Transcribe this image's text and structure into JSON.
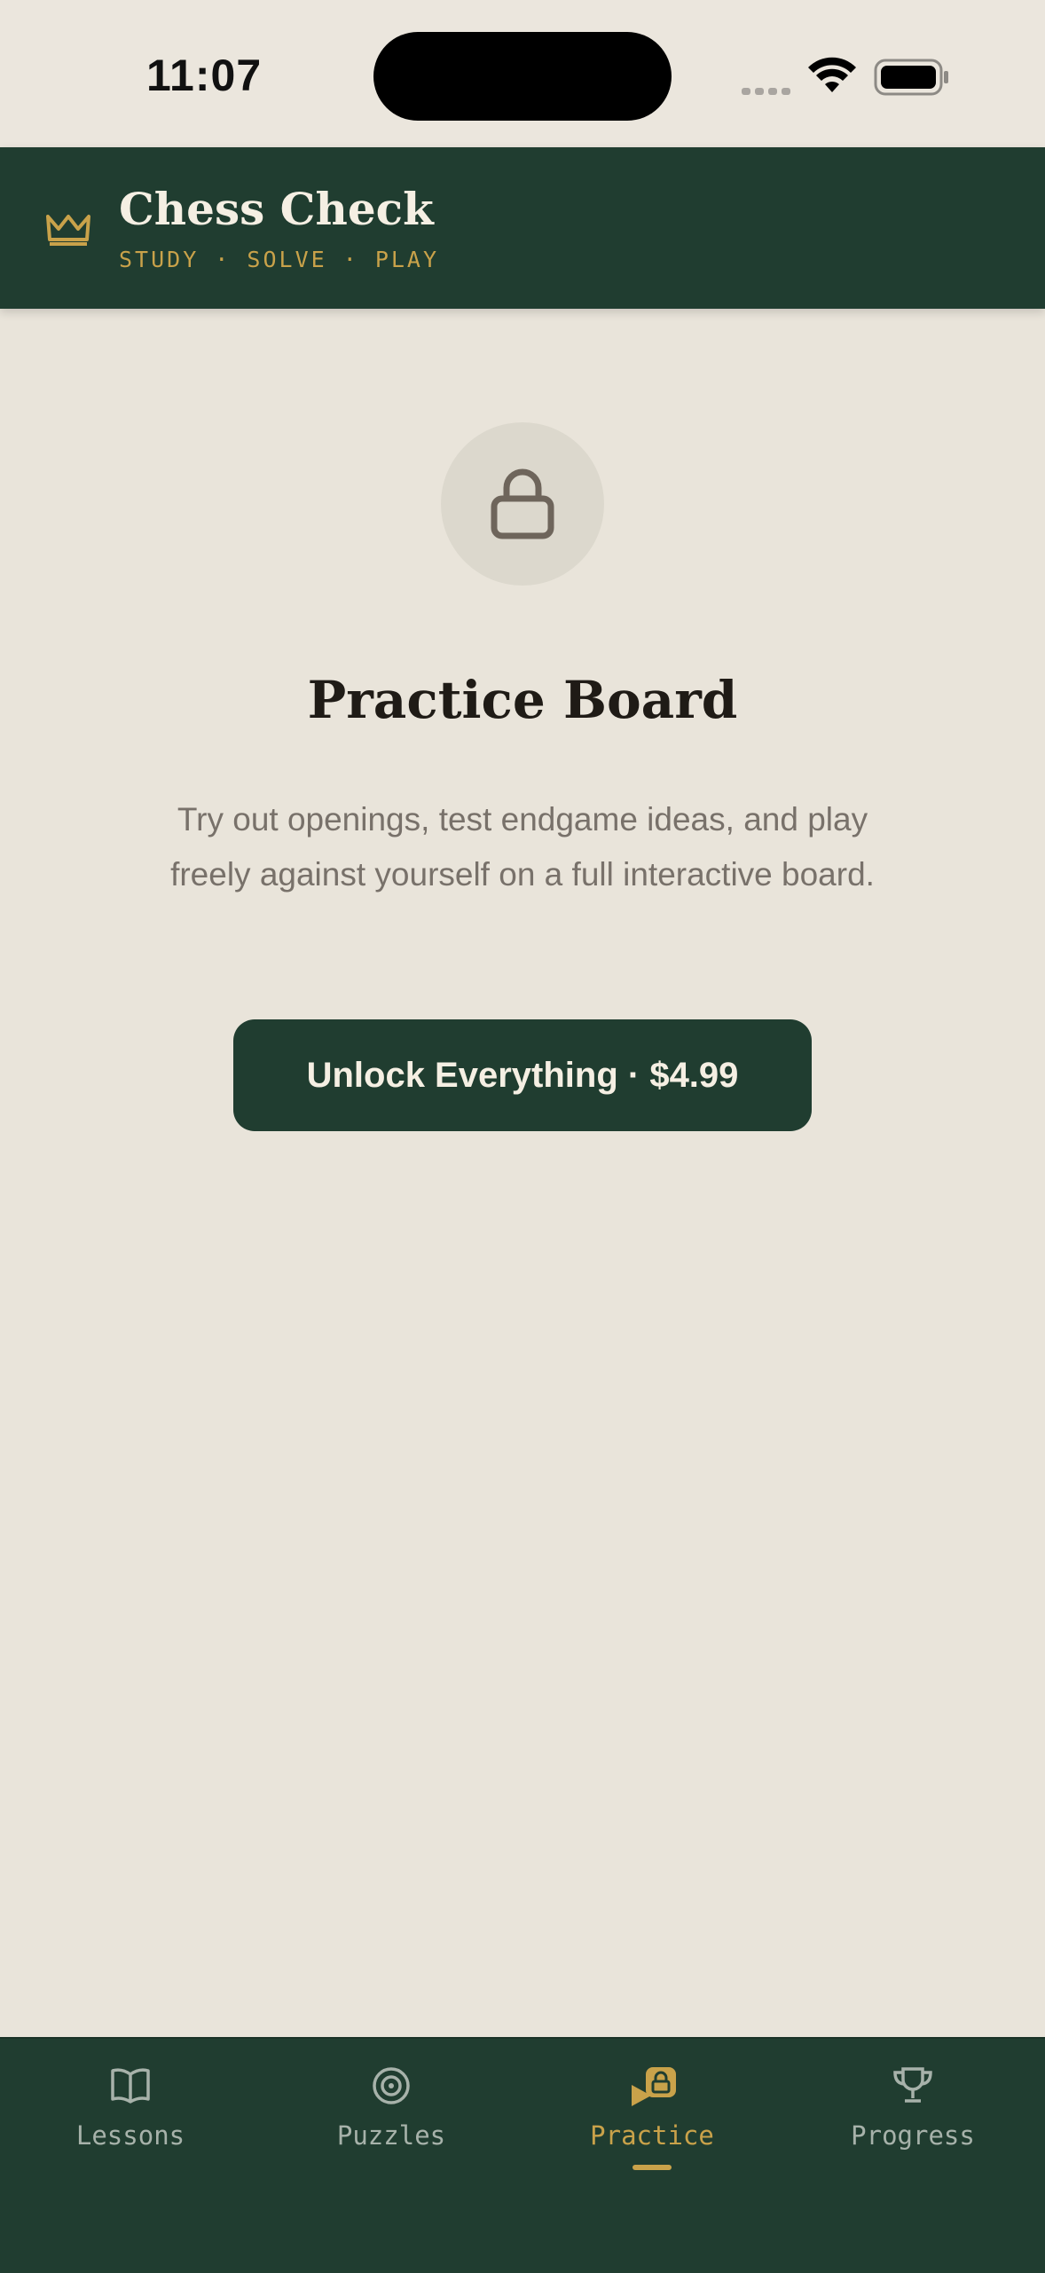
{
  "status_bar": {
    "time": "11:07"
  },
  "header": {
    "title": "Chess Check",
    "subtitle": "STUDY · SOLVE · PLAY"
  },
  "main": {
    "title": "Practice Board",
    "description": "Try out openings, test endgame ideas, and play freely against yourself on a full interactive board.",
    "unlock_label": "Unlock Everything · $4.99"
  },
  "tabs": [
    {
      "label": "Lessons",
      "icon": "book-icon"
    },
    {
      "label": "Puzzles",
      "icon": "target-icon"
    },
    {
      "label": "Practice",
      "icon": "play-lock-icon",
      "active": true
    },
    {
      "label": "Progress",
      "icon": "trophy-icon"
    }
  ],
  "colors": {
    "header_bg": "#203d30",
    "accent": "#c9a24a",
    "background": "#e9e4da"
  }
}
